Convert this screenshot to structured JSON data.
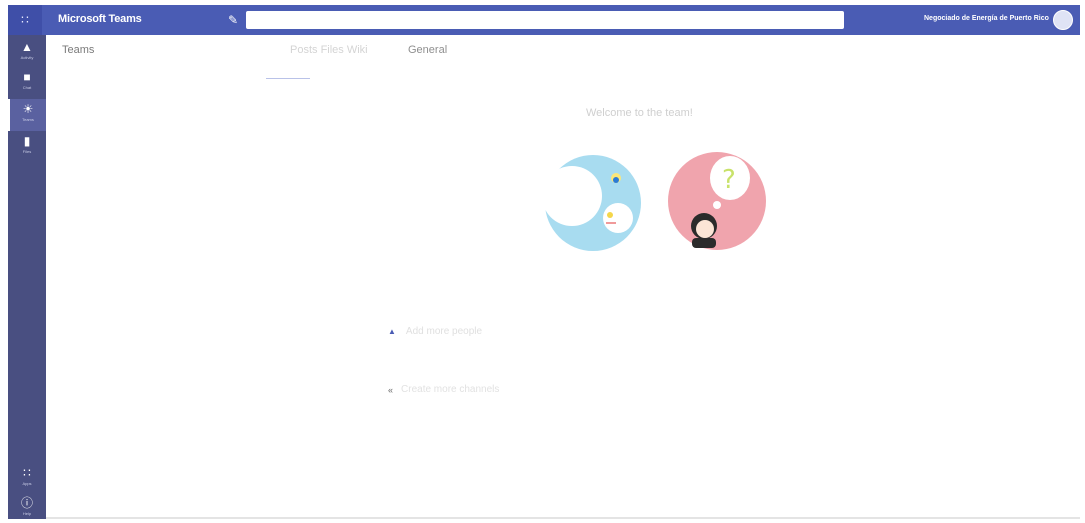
{
  "topbar": {
    "app_title": "Microsoft Teams",
    "search_placeholder": "",
    "org_name": "Negociado de Energía de Puerto Rico"
  },
  "rail": {
    "items": [
      {
        "label": "Activity",
        "icon": "bell-icon"
      },
      {
        "label": "Chat",
        "icon": "chat-icon"
      },
      {
        "label": "Teams",
        "icon": "teams-icon"
      },
      {
        "label": "Files",
        "icon": "file-icon"
      },
      {
        "label": "Apps",
        "icon": "apps-icon"
      },
      {
        "label": "Help",
        "icon": "help-icon"
      }
    ]
  },
  "content": {
    "teams_label": "Teams",
    "tabs": [
      {
        "label": "Posts Files Wiki"
      },
      {
        "label": "General"
      }
    ],
    "welcome_text": "Welcome to the team!",
    "add_text": "Add more people",
    "team_text": "Create more channels"
  },
  "colors": {
    "brand": "#4a5cb4",
    "rail": "#494f81",
    "illustration_left": "#a8dcf0",
    "illustration_right": "#f0a4ad"
  }
}
